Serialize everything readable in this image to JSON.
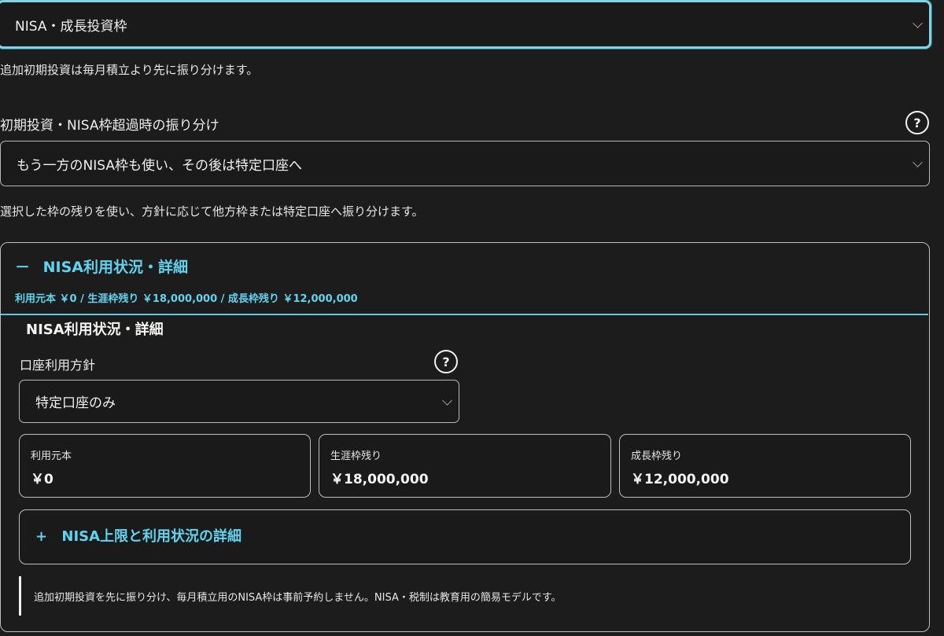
{
  "allocation_select": {
    "value": "NISA・成長投資枠"
  },
  "allocation_note": "追加初期投資は毎月積立より先に振り分けます。",
  "overflow": {
    "label": "初期投資・NISA枠超過時の振り分け",
    "help": "?",
    "value": "もう一方のNISA枠も使い、その後は特定口座へ",
    "note": "選択した枠の残りを使い、方針に応じて他方枠または特定口座へ振り分けます。"
  },
  "nisa_panel": {
    "toggle": "－",
    "title": "NISA利用状況・詳細",
    "summary": "利用元本 ￥0 / 生涯枠残り ￥18,000,000 / 成長枠残り ￥12,000,000",
    "section_title": "NISA利用状況・詳細",
    "policy_label": "口座利用方針",
    "policy_help": "?",
    "policy_value": "特定口座のみ",
    "cards": [
      {
        "label": "利用元本",
        "value": "￥0"
      },
      {
        "label": "生涯枠残り",
        "value": "￥18,000,000"
      },
      {
        "label": "成長枠残り",
        "value": "￥12,000,000"
      }
    ],
    "details": {
      "toggle": "+",
      "title": "NISA上限と利用状況の詳細"
    },
    "footnote": "追加初期投資を先に振り分け、毎月積立用のNISA枠は事前予約しません。NISA・税制は教育用の簡易モデルです。"
  }
}
